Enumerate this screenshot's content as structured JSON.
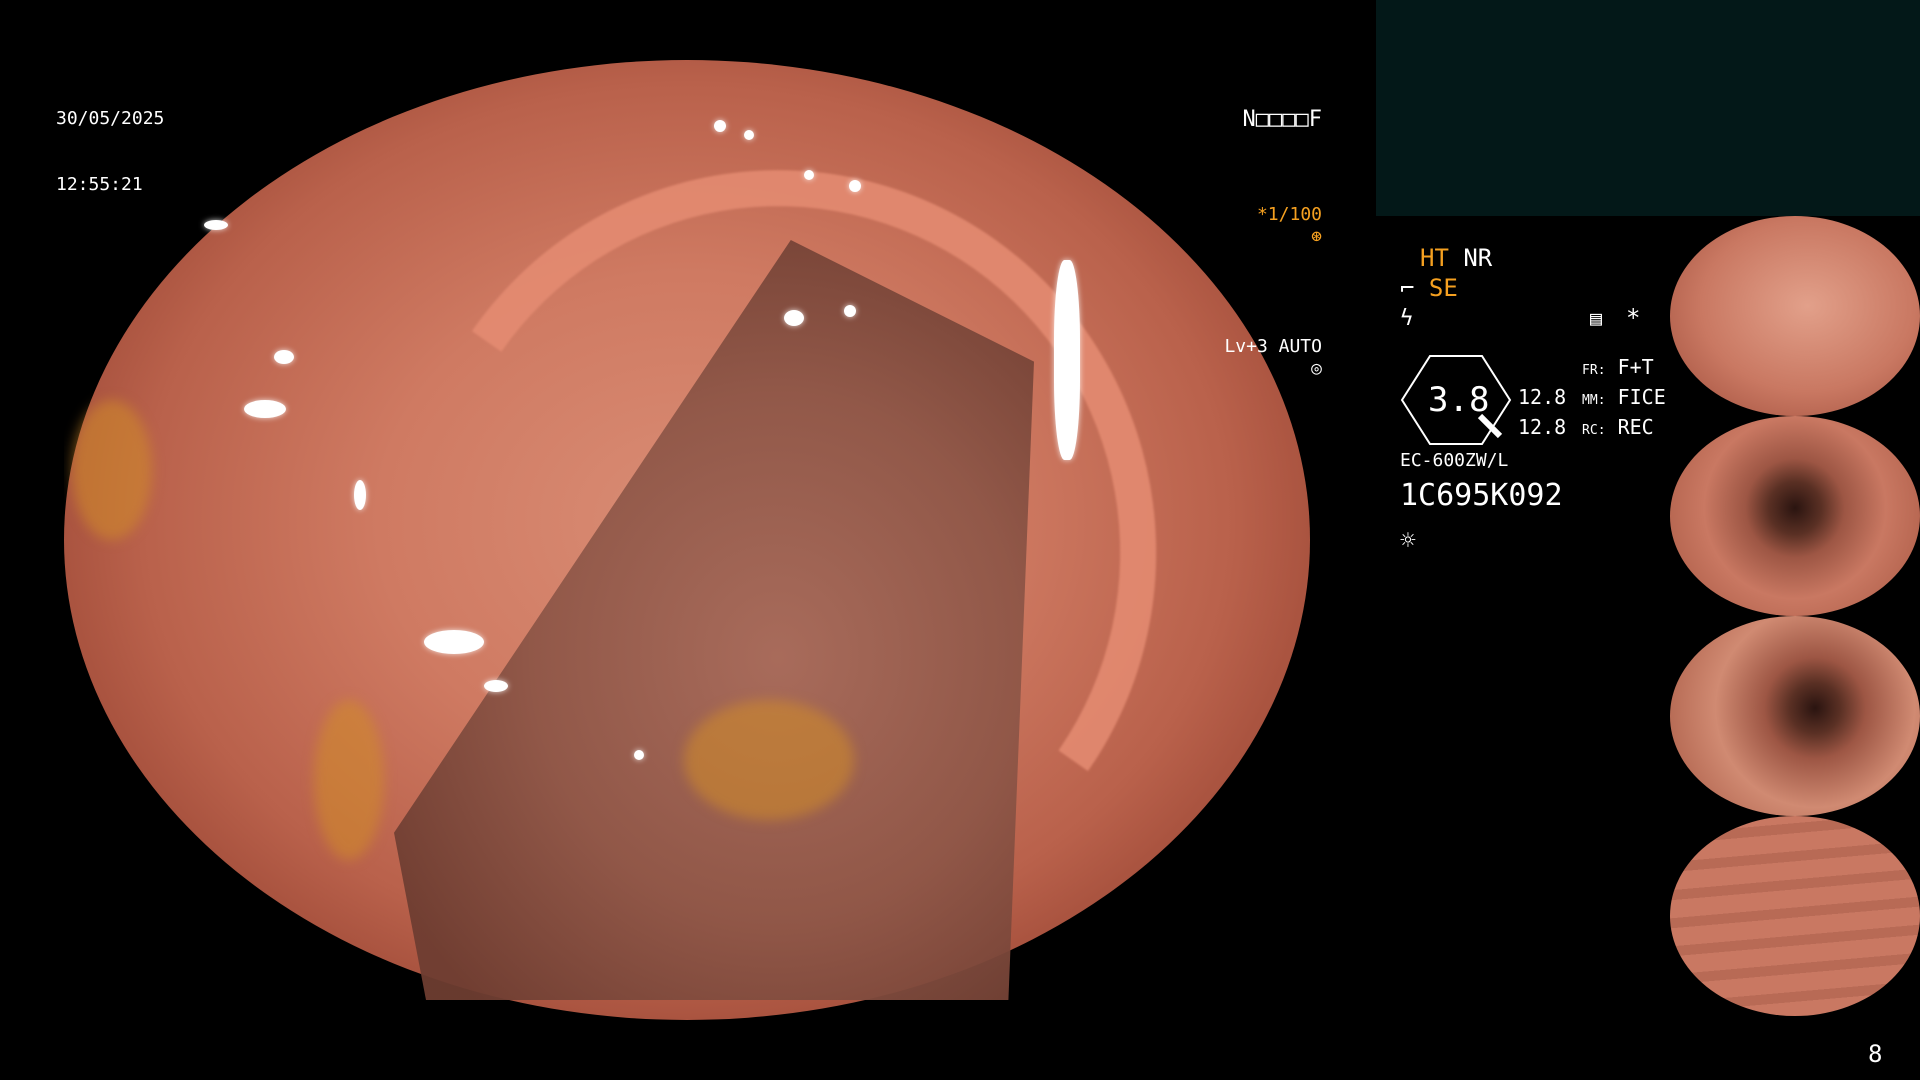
{
  "overlay": {
    "date": "30/05/2025",
    "time": "12:55:21",
    "top_right": {
      "line1": "N□□□□F",
      "line2_exposure": "*1/100",
      "line3": "Lv+3 AUTO"
    }
  },
  "side_panel": {
    "flags": {
      "ht": "HT",
      "nr": "NR",
      "se": "SE"
    },
    "icons": {
      "scope_icon": "scope-icon",
      "lightning_icon": "lightning-icon",
      "memo_icon": "memo-icon",
      "asterisk": "*"
    },
    "gauge": {
      "value": "3.8",
      "row1": {
        "left": "",
        "label": "FR:",
        "value": "F+T"
      },
      "row2": {
        "left": "12.8",
        "label": "MM:",
        "value": "FICE"
      },
      "row3": {
        "left": "12.8",
        "label": "RC:",
        "value": "REC"
      }
    },
    "scope_model": "EC-600ZW/L",
    "serial": "1C695K092",
    "brightness_icon": "sun-icon"
  },
  "thumbnails": [
    {
      "name": "thumb-1"
    },
    {
      "name": "thumb-2"
    },
    {
      "name": "thumb-3"
    },
    {
      "name": "thumb-4"
    }
  ],
  "page_number": "8",
  "colors": {
    "accent_orange": "#f5a020",
    "teal_panel": "#031818"
  }
}
